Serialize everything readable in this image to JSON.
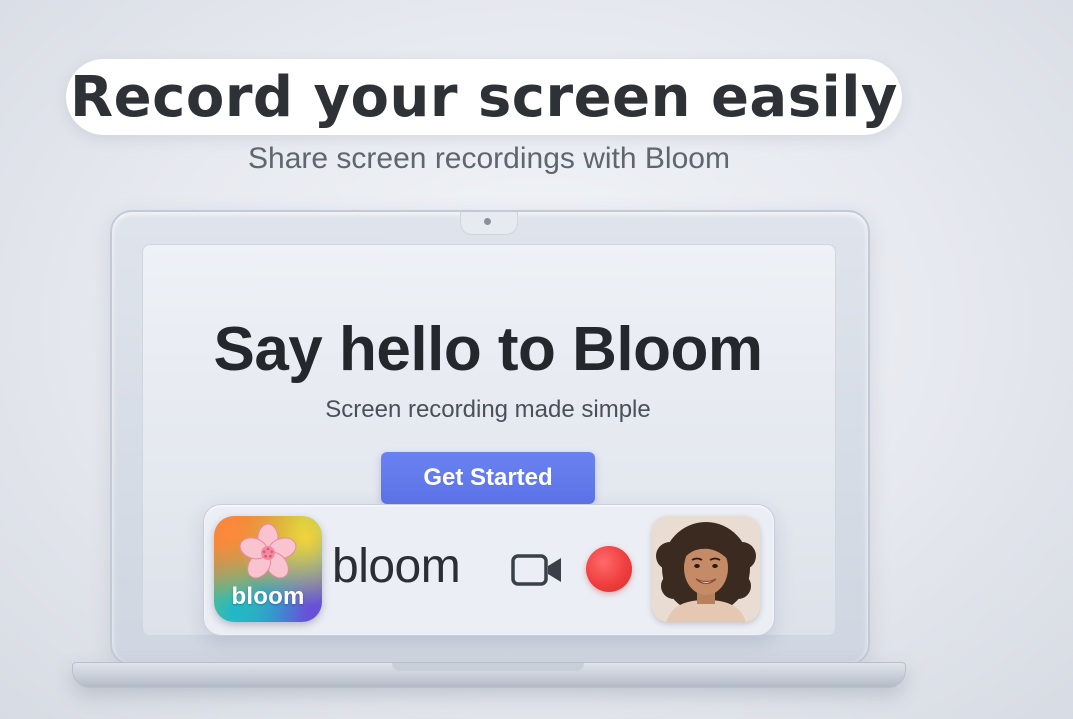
{
  "hero": {
    "headline": "Record your screen easily",
    "subheadline": "Share screen recordings with Bloom"
  },
  "screen": {
    "title": "Say hello to Bloom",
    "subtitle": "Screen recording made simple",
    "cta_label": "Get Started"
  },
  "recorder": {
    "app_icon_label": "bloom",
    "app_icon": "cherry-blossom-icon",
    "brand_wordmark": "bloom",
    "camera_icon": "video-camera-icon",
    "record_icon": "record-dot-icon",
    "avatar": "user-avatar"
  },
  "colors": {
    "cta": "#5b73e8",
    "record": "#ef3e3e",
    "blossom": "#f7b7c4"
  }
}
